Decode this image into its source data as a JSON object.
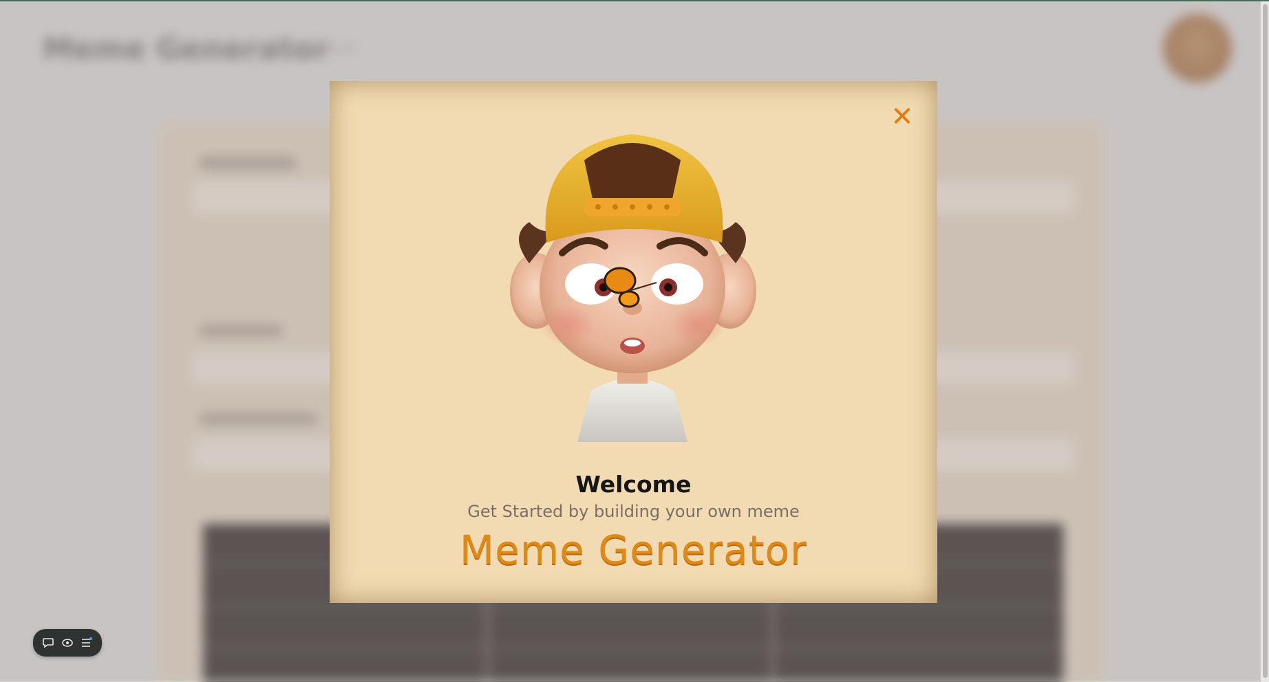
{
  "background": {
    "app_title": "Meme Generator",
    "app_subtitle": "by Prajwal"
  },
  "modal": {
    "close_label": "✕",
    "welcome": "Welcome",
    "subtitle": "Get Started by building your own meme",
    "brand": "Meme Generator",
    "hero_image": "cartoon-boy-with-butterfly-on-nose"
  },
  "toolbar": {
    "icons": [
      "chat-bubble-icon",
      "eye-icon",
      "list-icon"
    ]
  },
  "colors": {
    "modal_bg": "#f2dbb2",
    "accent": "#e07c12",
    "brand": "#dd8a1a"
  }
}
